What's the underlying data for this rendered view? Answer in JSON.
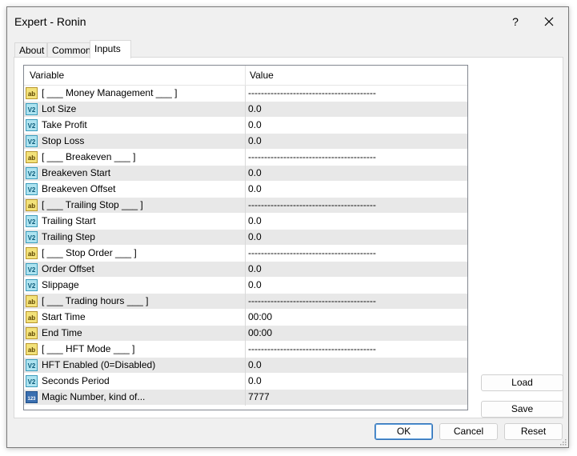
{
  "window": {
    "title": "Expert - Ronin",
    "help_label": "?"
  },
  "tabs": [
    {
      "label": "About"
    },
    {
      "label": "Common"
    },
    {
      "label": "Inputs"
    }
  ],
  "grid": {
    "col_variable": "Variable",
    "col_value": "Value",
    "rows": [
      {
        "icon": "ab",
        "name": "[ ___ Money Management ___ ]",
        "value": "----------------------------------------"
      },
      {
        "icon": "v2",
        "name": "Lot Size",
        "value": "0.0"
      },
      {
        "icon": "v2",
        "name": "Take Profit",
        "value": "0.0"
      },
      {
        "icon": "v2",
        "name": "Stop Loss",
        "value": "0.0"
      },
      {
        "icon": "ab",
        "name": "[ ___ Breakeven ___ ]",
        "value": "----------------------------------------"
      },
      {
        "icon": "v2",
        "name": "Breakeven Start",
        "value": "0.0"
      },
      {
        "icon": "v2",
        "name": "Breakeven Offset",
        "value": "0.0"
      },
      {
        "icon": "ab",
        "name": "[ ___ Trailing Stop ___ ]",
        "value": "----------------------------------------"
      },
      {
        "icon": "v2",
        "name": "Trailing Start",
        "value": "0.0"
      },
      {
        "icon": "v2",
        "name": "Trailing Step",
        "value": "0.0"
      },
      {
        "icon": "ab",
        "name": "[ ___ Stop Order ___ ]",
        "value": "----------------------------------------"
      },
      {
        "icon": "v2",
        "name": "Order Offset",
        "value": "0.0"
      },
      {
        "icon": "v2",
        "name": "Slippage",
        "value": "0.0"
      },
      {
        "icon": "ab",
        "name": "[ ___ Trading hours ___ ]",
        "value": "----------------------------------------"
      },
      {
        "icon": "ab",
        "name": "Start Time",
        "value": "00:00"
      },
      {
        "icon": "ab",
        "name": "End Time",
        "value": "00:00"
      },
      {
        "icon": "ab",
        "name": "[ ___ HFT Mode ___ ]",
        "value": "----------------------------------------"
      },
      {
        "icon": "v2",
        "name": "HFT Enabled (0=Disabled)",
        "value": "0.0"
      },
      {
        "icon": "v2",
        "name": "Seconds Period",
        "value": "0.0"
      },
      {
        "icon": "123",
        "name": "Magic Number, kind of...",
        "value": "7777"
      }
    ]
  },
  "side_buttons": {
    "load": "Load",
    "save": "Save"
  },
  "footer": {
    "ok": "OK",
    "cancel": "Cancel",
    "reset": "Reset"
  },
  "icons": {
    "ab": {
      "label": "ab",
      "name": "string-type-icon",
      "fill": "#f3e27a",
      "stroke": "#b8962c",
      "text": "#5a4300"
    },
    "v2": {
      "label": "V2",
      "name": "double-type-icon",
      "fill": "#aee3f0",
      "stroke": "#3a9cbc",
      "text": "#0d5c7a"
    },
    "123": {
      "label": "123",
      "name": "integer-type-icon",
      "fill": "#3a6fb0",
      "stroke": "#1f4f8a",
      "text": "#ffffff"
    }
  }
}
